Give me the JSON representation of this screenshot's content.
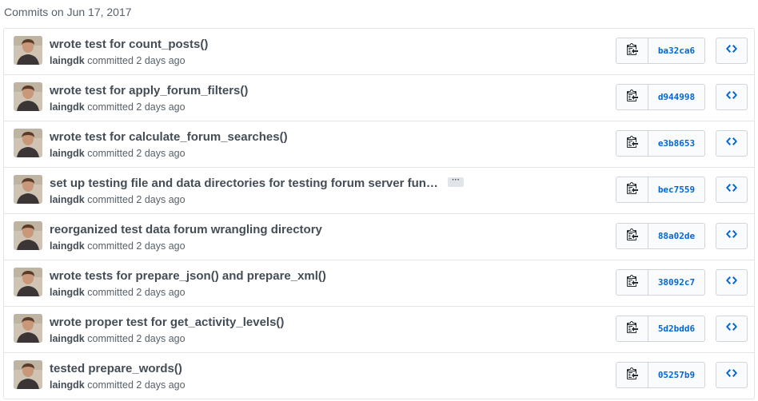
{
  "header": {
    "title": "Commits on Jun 17, 2017"
  },
  "commits": [
    {
      "message": "wrote test for count_posts()",
      "author": "laingdk",
      "action": "committed",
      "time": "2 days ago",
      "sha": "ba32ca6",
      "has_ellipsis": false
    },
    {
      "message": "wrote test for apply_forum_filters()",
      "author": "laingdk",
      "action": "committed",
      "time": "2 days ago",
      "sha": "d944998",
      "has_ellipsis": false
    },
    {
      "message": "wrote test for calculate_forum_searches()",
      "author": "laingdk",
      "action": "committed",
      "time": "2 days ago",
      "sha": "e3b8653",
      "has_ellipsis": false
    },
    {
      "message": "set up testing file and data directories for testing forum server fun…",
      "author": "laingdk",
      "action": "committed",
      "time": "2 days ago",
      "sha": "bec7559",
      "has_ellipsis": true,
      "ellipsis_label": "···"
    },
    {
      "message": "reorganized test data forum wrangling directory",
      "author": "laingdk",
      "action": "committed",
      "time": "2 days ago",
      "sha": "88a02de",
      "has_ellipsis": false
    },
    {
      "message": "wrote tests for prepare_json() and prepare_xml()",
      "author": "laingdk",
      "action": "committed",
      "time": "2 days ago",
      "sha": "38092c7",
      "has_ellipsis": false
    },
    {
      "message": "wrote proper test for get_activity_levels()",
      "author": "laingdk",
      "action": "committed",
      "time": "2 days ago",
      "sha": "5d2bdd6",
      "has_ellipsis": false
    },
    {
      "message": "tested prepare_words()",
      "author": "laingdk",
      "action": "committed",
      "time": "2 days ago",
      "sha": "05257b9",
      "has_ellipsis": false
    }
  ],
  "icons": {
    "copy": "clippy-icon",
    "browse": "code-icon"
  },
  "colors": {
    "sha_link": "#0366d6",
    "border": "#e1e4e8",
    "muted_text": "#586069"
  }
}
